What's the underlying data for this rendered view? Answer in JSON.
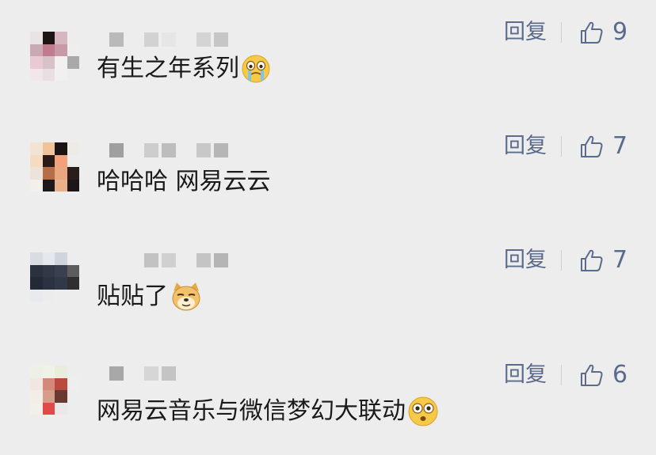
{
  "comments": [
    {
      "text": "有生之年系列",
      "emoji": "crying-face-emoji",
      "reply_label": "回复",
      "likes": "9"
    },
    {
      "text": "哈哈哈 网易云云",
      "emoji": "",
      "reply_label": "回复",
      "likes": "7"
    },
    {
      "text": "贴贴了",
      "emoji": "doge-emoji",
      "reply_label": "回复",
      "likes": "7"
    },
    {
      "text": "网易云音乐与微信梦幻大联动",
      "emoji": "surprised-face-emoji",
      "reply_label": "回复",
      "likes": "6"
    }
  ],
  "colors": {
    "background": "#ededed",
    "link": "#5b6b8c",
    "text": "#1a1a1a"
  }
}
